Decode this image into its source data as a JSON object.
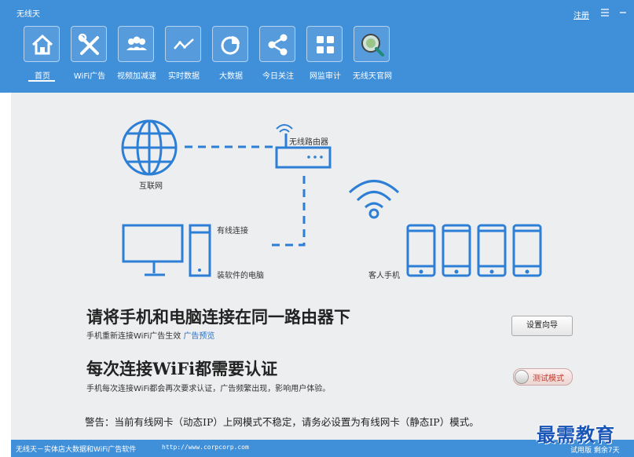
{
  "app": {
    "title": "无线天",
    "register": "注册"
  },
  "nav": {
    "items": [
      {
        "label": "首页",
        "icon": "home-icon"
      },
      {
        "label": "WiFi广告",
        "icon": "tools-icon"
      },
      {
        "label": "视频加减速",
        "icon": "users-icon"
      },
      {
        "label": "实时数据",
        "icon": "line-chart-icon"
      },
      {
        "label": "大数据",
        "icon": "pie-chart-icon"
      },
      {
        "label": "今日关注",
        "icon": "share-icon"
      },
      {
        "label": "网监审计",
        "icon": "grid-icon"
      },
      {
        "label": "无线天官网",
        "icon": "globe-link-icon"
      }
    ]
  },
  "diagram": {
    "internet": "互联网",
    "router": "无线路由器",
    "wired": "有线连接",
    "pc": "装软件的电脑",
    "phones": "客人手机"
  },
  "section1": {
    "heading": "请将手机和电脑连接在同一路由器下",
    "subtext": "手机重新连接WiFi广告生效",
    "link": "广告预览",
    "button": "设置向导"
  },
  "section2": {
    "heading": "每次连接WiFi都需要认证",
    "subtext": "手机每次连接WiFi都会再次要求认证，广告频繁出现，影响用户体验。",
    "toggle": "测试模式"
  },
  "warning": "警告：当前有线网卡（动态IP）上网模式不稳定，请务必设置为有线网卡（静态IP）模式。",
  "status": {
    "left": "无线天－实体店大数据和WiFi广告软件",
    "url": "http://www.corpcorp.com",
    "right": "试用版 剩余7天"
  },
  "watermark": "最需教育",
  "colors": {
    "header": "#3f8fd9",
    "diagram": "#2d7fd6",
    "link": "#2a6fc2"
  }
}
